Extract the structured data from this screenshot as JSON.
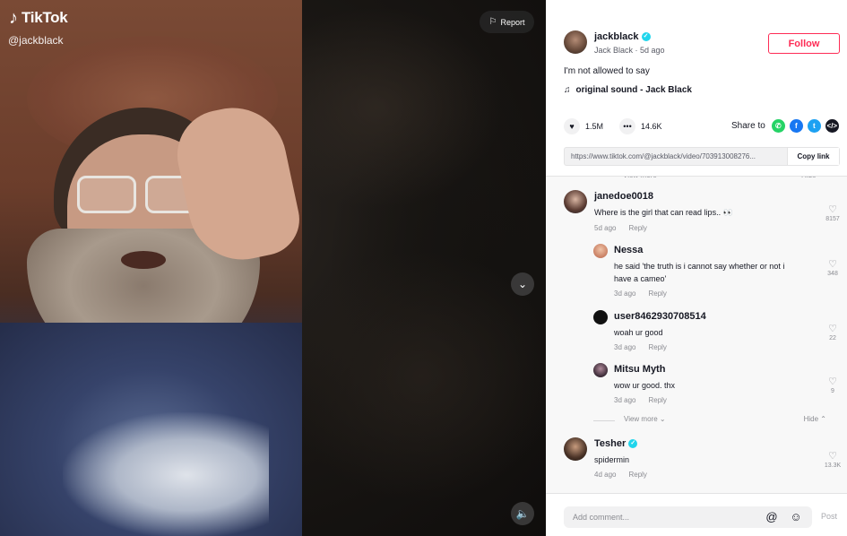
{
  "video": {
    "logo_text": "TikTok",
    "handle": "@jackblack",
    "report_label": "Report"
  },
  "author": {
    "username": "jackblack",
    "sub": "Jack Black · 5d ago",
    "follow_label": "Follow",
    "caption": "I'm not allowed to say",
    "sound": "original sound - Jack Black"
  },
  "stats": {
    "likes": "1.5M",
    "comments": "14.6K",
    "share_label": "Share to"
  },
  "link": {
    "url": "https://www.tiktok.com/@jackblack/video/703913008276...",
    "copy_label": "Copy link"
  },
  "comments": [
    {
      "username": "janedoe0018",
      "text": "Where is the girl that can read lips.. 👀",
      "time": "5d ago",
      "reply_label": "Reply",
      "likes": "8157",
      "verified": false
    },
    {
      "username": "Nessa",
      "text_lines": [
        "he said 'the truth is i cannot say whether or not i",
        "have a cameo'"
      ],
      "time": "3d ago",
      "reply_label": "Reply",
      "likes": "348"
    },
    {
      "username": "user8462930708514",
      "text": "woah ur good",
      "time": "3d ago",
      "reply_label": "Reply",
      "likes": "22"
    },
    {
      "username": "Mitsu Myth",
      "text": "wow ur good. thx",
      "time": "3d ago",
      "reply_label": "Reply",
      "likes": "9"
    },
    {
      "username": "Tesher",
      "text": "spidermin",
      "time": "4d ago",
      "reply_label": "Reply",
      "likes": "13.3K",
      "verified": true
    }
  ],
  "view_more_label": "View more",
  "hide_label": "Hide",
  "comment_input": {
    "placeholder": "Add comment...",
    "post_label": "Post"
  },
  "colors": {
    "accent": "#fe2c55",
    "verified": "#20d5ec",
    "whatsapp": "#25d366",
    "facebook": "#1877f2",
    "twitter": "#1da1f2",
    "embed": "#161823"
  }
}
